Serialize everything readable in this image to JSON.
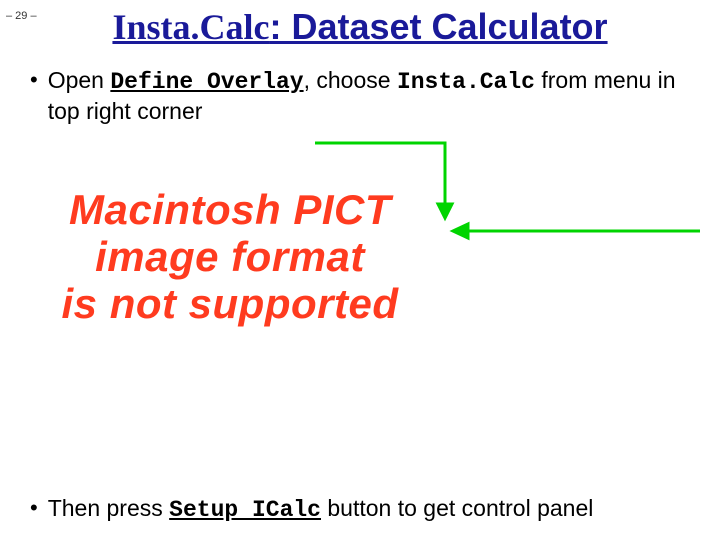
{
  "page_number": "– 29 –",
  "title_brand": "Insta.Calc",
  "title_rest": ": Dataset Calculator",
  "bullet1": {
    "pre": "Open ",
    "defineOverlay": "Define Overlay",
    "mid": ", choose ",
    "instaCalc": "Insta.Calc",
    "post": " from menu in top right corner"
  },
  "pict_msg": {
    "l1": "Macintosh PICT",
    "l2": "image format",
    "l3": "is not supported"
  },
  "bullet2": {
    "pre": "Then press ",
    "setupICalc": "Setup ICalc",
    "post": " button to get control panel"
  }
}
